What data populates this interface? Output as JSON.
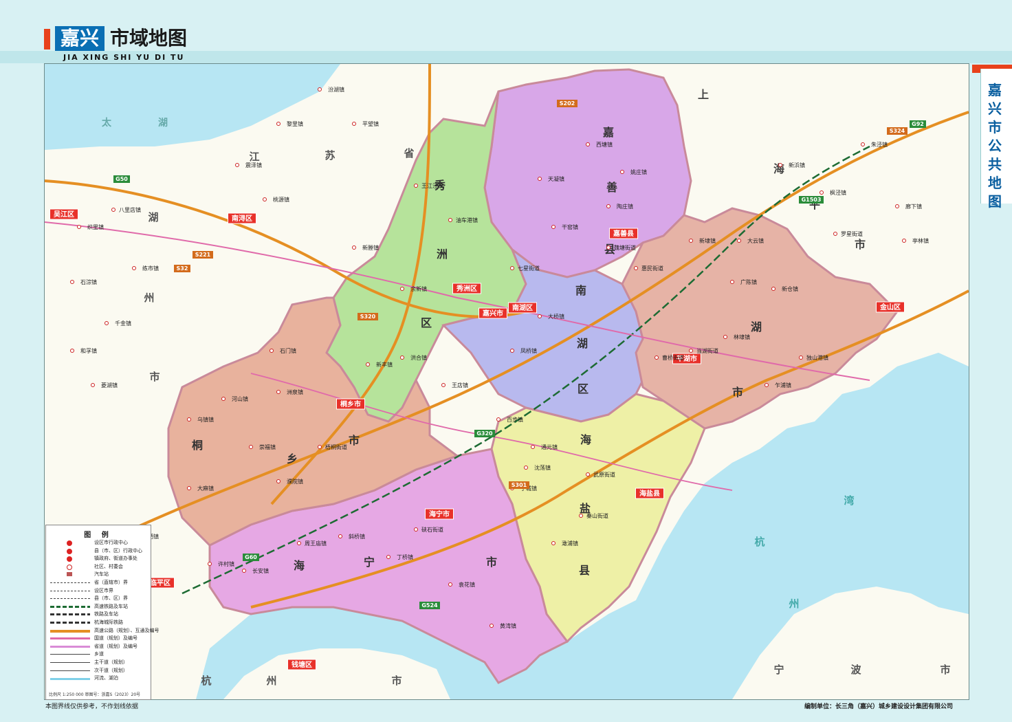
{
  "header": {
    "title_highlight": "嘉兴",
    "title_rest": "市域地图",
    "title_pinyin": "JIA XING SHI YU DI TU"
  },
  "side_label": {
    "text": "嘉兴市公共地图"
  },
  "colors": {
    "sea": "#b7e6f3",
    "outside": "#fbfaf1",
    "xiuzhou": "#b6e39b",
    "nanhu": "#b8b9ee",
    "jiashan": "#d8a7e8",
    "pinghu": "#e6b3a6",
    "haiyan": "#eef0a6",
    "haining": "#e6a8e4",
    "tongxiang": "#e8b29d",
    "border": "#c98a9a",
    "highway": "#e58f23"
  },
  "map": {
    "regions": [
      {
        "name": "xiuzhou",
        "chars": [
          "秀",
          "洲",
          "区"
        ]
      },
      {
        "name": "nanhu",
        "chars": [
          "南",
          "湖",
          "区"
        ]
      },
      {
        "name": "jiashan",
        "chars": [
          "嘉",
          "善",
          "县"
        ]
      },
      {
        "name": "pinghu",
        "chars": [
          "平",
          "湖",
          "市"
        ]
      },
      {
        "name": "haiyan",
        "chars": [
          "海",
          "盐",
          "县"
        ]
      },
      {
        "name": "haining",
        "chars": [
          "海",
          "宁",
          "市"
        ]
      },
      {
        "name": "tongxiang",
        "chars": [
          "桐",
          "乡",
          "市"
        ]
      }
    ],
    "neighbors": {
      "jiangsu": [
        "江",
        "苏",
        "省"
      ],
      "shanghai": [
        "上",
        "海",
        "市"
      ],
      "huzhou": [
        "湖",
        "州",
        "市"
      ],
      "hangzhou": [
        "杭",
        "州",
        "市"
      ],
      "ningbo": [
        "宁",
        "波",
        "市"
      ],
      "taihu": [
        "太",
        "湖"
      ],
      "hangzhou_bay": [
        "杭",
        "州",
        "湾"
      ]
    },
    "city_badges": {
      "jiaxing": "嘉兴市",
      "xiuzhou": "秀洲区",
      "nanhu": "南湖区",
      "jiashan": "嘉善县",
      "pinghu": "平湖市",
      "haiyan": "海盐县",
      "haining": "海宁市",
      "tongxiang": "桐乡市",
      "wujiang": "吴江区",
      "nanxun": "南浔区",
      "jinshan": "金山区",
      "linping": "临平区",
      "qiantang": "钱塘区"
    },
    "towns": [
      "王江泾镇",
      "油车港镇",
      "新塍镇",
      "洪合镇",
      "王店镇",
      "新丰镇",
      "凤桥镇",
      "大桥镇",
      "西塘镇",
      "天凝镇",
      "干窑镇",
      "姚庄镇",
      "陶庄镇",
      "惠民街道",
      "魏塘街道",
      "新埭镇",
      "广陈镇",
      "林埭镇",
      "独山港镇",
      "乍浦镇",
      "当湖街道",
      "曹桥街道",
      "百步镇",
      "通元镇",
      "澉浦镇",
      "武原街道",
      "秦山街道",
      "于城镇",
      "沈荡镇",
      "许村镇",
      "长安镇",
      "周王庙镇",
      "斜桥镇",
      "丁桥镇",
      "袁花镇",
      "黄湾镇",
      "硖石街道",
      "崇福镇",
      "洲泉镇",
      "濮院镇",
      "乌镇镇",
      "大麻镇",
      "石门镇",
      "河山镇",
      "梧桐街道",
      "八里店镇",
      "织里镇",
      "练市镇",
      "千金镇",
      "石淙镇",
      "和孚镇",
      "菱湖镇",
      "塘栖镇",
      "新仓镇",
      "大云镇",
      "罗星街道",
      "枫泾镇",
      "廊下镇",
      "新浜镇",
      "朱泾镇",
      "亭林镇",
      "汾湖镇",
      "黎里镇",
      "平望镇",
      "震泽镇",
      "桃源镇",
      "七星街道",
      "余新镇"
    ],
    "road_codes": [
      "G50",
      "G60",
      "G92",
      "G1503",
      "S32",
      "S202",
      "S320",
      "S221",
      "G320",
      "G524",
      "S301",
      "S324"
    ]
  },
  "legend": {
    "title": "图 例",
    "items": [
      "设区市行政中心",
      "县（市、区）行政中心",
      "镇政府、街道办事处",
      "社区、村委会",
      "汽车站",
      "省（直辖市）界",
      "设区市界",
      "县（市、区）界",
      "高速铁路及车站",
      "铁路及车站",
      "杭海城际铁路",
      "高速公路（规划）、互通及编号",
      "国道（规划）及编号",
      "省道（规划）及编号",
      "乡道",
      "主干道（规划）",
      "次干道（规划）",
      "河流、湖泊"
    ],
    "scale_note": "比例尺 1:250 000   审图号：浙嘉S（2023）20号"
  },
  "footer": {
    "disclaimer": "本图界线仅供参考，不作划线依据",
    "publisher": "编制单位：长三角（嘉兴）城乡建设设计集团有限公司"
  }
}
